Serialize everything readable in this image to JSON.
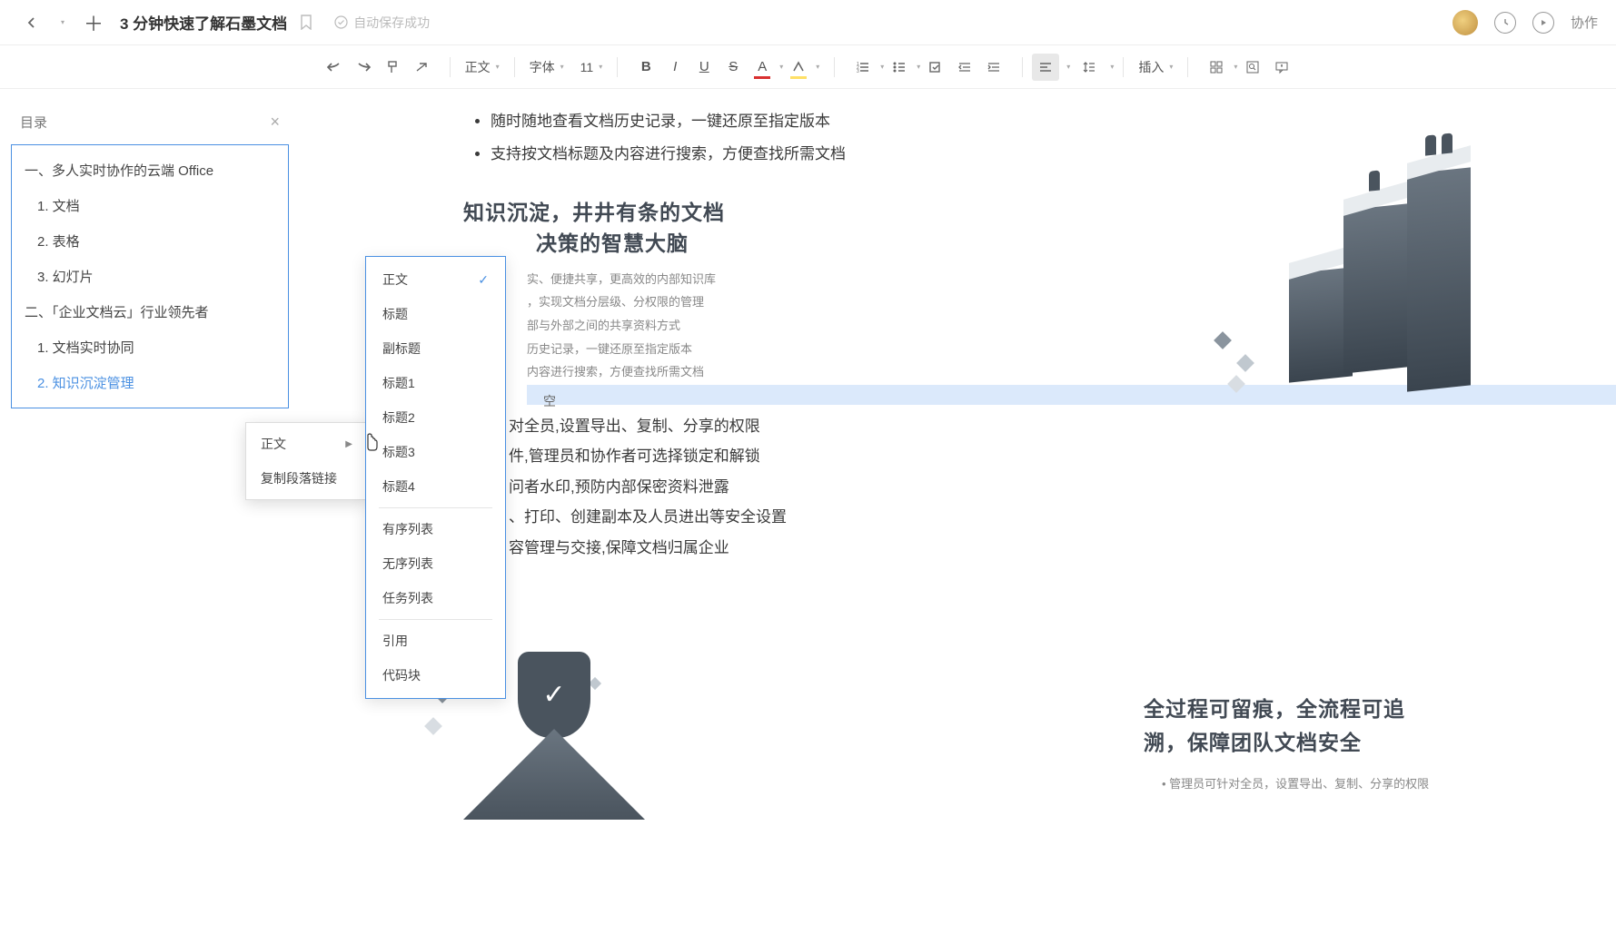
{
  "header": {
    "doc_title": "3 分钟快速了解石墨文档",
    "autosave_text": "自动保存成功",
    "collab_label": "协作"
  },
  "toolbar": {
    "style_label": "正文",
    "font_label": "字体",
    "size_label": "11",
    "insert_label": "插入"
  },
  "toc": {
    "title": "目录",
    "items": [
      {
        "label": "一、多人实时协作的云端 Office",
        "level": 1
      },
      {
        "label": "1. 文档",
        "level": 2
      },
      {
        "label": "2. 表格",
        "level": 2
      },
      {
        "label": "3. 幻灯片",
        "level": 2
      },
      {
        "label": "二、「企业文档云」行业领先者",
        "level": 1
      },
      {
        "label": "1. 文档实时协同",
        "level": 2
      },
      {
        "label": "2. 知识沉淀管理",
        "level": 2,
        "active": true
      }
    ]
  },
  "content": {
    "top_bullets": [
      "随时随地查看文档历史记录，一键还原至指定版本",
      "支持按文档标题及内容进行搜索，方便查找所需文档"
    ],
    "section_title_l1": "知识沉淀，井井有条的文档",
    "section_title_l2": "决策的智慧大脑",
    "peek_bullets": [
      "实、便捷共享，更高效的内部知识库",
      "，实现文档分层级、分权限的管理",
      "部与外部之间的共享资料方式",
      "历史记录，一键还原至指定版本",
      "内容进行搜索，方便查找所需文档"
    ],
    "peek_char": "空",
    "numbered": [
      "对全员,设置导出、复制、分享的权限",
      "件,管理员和协作者可选择锁定和解锁",
      "问者水印,预防内部保密资料泄露",
      "、打印、创建副本及人员进出等安全设置",
      "容管理与交接,保障文档归属企业"
    ],
    "section2_l1": "全过程可留痕，全流程可追",
    "section2_l2": "溯，保障团队文档安全",
    "section2_bullet": "管理员可针对全员，设置导出、复制、分享的权限"
  },
  "context_menu": {
    "items": [
      {
        "label": "正文",
        "has_sub": true
      },
      {
        "label": "复制段落链接"
      }
    ]
  },
  "sub_menu": {
    "groups": [
      [
        {
          "label": "正文",
          "checked": true
        },
        {
          "label": "标题"
        },
        {
          "label": "副标题"
        },
        {
          "label": "标题1"
        },
        {
          "label": "标题2"
        },
        {
          "label": "标题3"
        },
        {
          "label": "标题4"
        }
      ],
      [
        {
          "label": "有序列表"
        },
        {
          "label": "无序列表"
        },
        {
          "label": "任务列表"
        }
      ],
      [
        {
          "label": "引用"
        },
        {
          "label": "代码块"
        }
      ]
    ]
  }
}
